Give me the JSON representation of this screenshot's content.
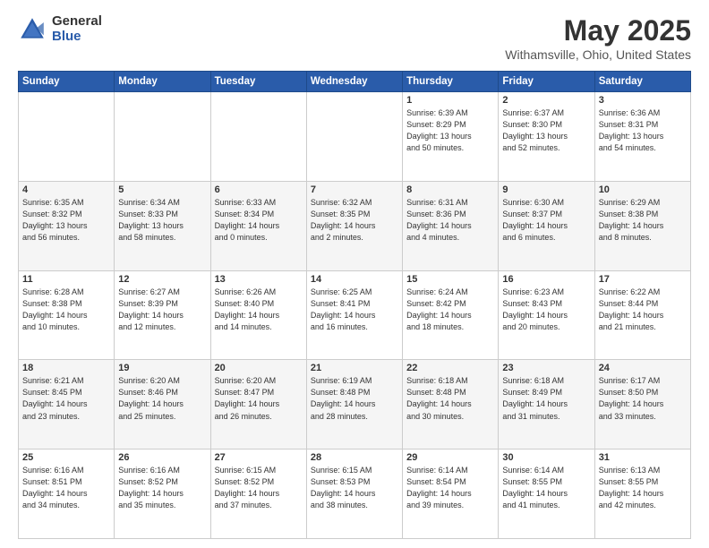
{
  "header": {
    "logo_general": "General",
    "logo_blue": "Blue",
    "title": "May 2025",
    "location": "Withamsville, Ohio, United States"
  },
  "days_of_week": [
    "Sunday",
    "Monday",
    "Tuesday",
    "Wednesday",
    "Thursday",
    "Friday",
    "Saturday"
  ],
  "weeks": [
    [
      {
        "day": "",
        "info": ""
      },
      {
        "day": "",
        "info": ""
      },
      {
        "day": "",
        "info": ""
      },
      {
        "day": "",
        "info": ""
      },
      {
        "day": "1",
        "info": "Sunrise: 6:39 AM\nSunset: 8:29 PM\nDaylight: 13 hours\nand 50 minutes."
      },
      {
        "day": "2",
        "info": "Sunrise: 6:37 AM\nSunset: 8:30 PM\nDaylight: 13 hours\nand 52 minutes."
      },
      {
        "day": "3",
        "info": "Sunrise: 6:36 AM\nSunset: 8:31 PM\nDaylight: 13 hours\nand 54 minutes."
      }
    ],
    [
      {
        "day": "4",
        "info": "Sunrise: 6:35 AM\nSunset: 8:32 PM\nDaylight: 13 hours\nand 56 minutes."
      },
      {
        "day": "5",
        "info": "Sunrise: 6:34 AM\nSunset: 8:33 PM\nDaylight: 13 hours\nand 58 minutes."
      },
      {
        "day": "6",
        "info": "Sunrise: 6:33 AM\nSunset: 8:34 PM\nDaylight: 14 hours\nand 0 minutes."
      },
      {
        "day": "7",
        "info": "Sunrise: 6:32 AM\nSunset: 8:35 PM\nDaylight: 14 hours\nand 2 minutes."
      },
      {
        "day": "8",
        "info": "Sunrise: 6:31 AM\nSunset: 8:36 PM\nDaylight: 14 hours\nand 4 minutes."
      },
      {
        "day": "9",
        "info": "Sunrise: 6:30 AM\nSunset: 8:37 PM\nDaylight: 14 hours\nand 6 minutes."
      },
      {
        "day": "10",
        "info": "Sunrise: 6:29 AM\nSunset: 8:38 PM\nDaylight: 14 hours\nand 8 minutes."
      }
    ],
    [
      {
        "day": "11",
        "info": "Sunrise: 6:28 AM\nSunset: 8:38 PM\nDaylight: 14 hours\nand 10 minutes."
      },
      {
        "day": "12",
        "info": "Sunrise: 6:27 AM\nSunset: 8:39 PM\nDaylight: 14 hours\nand 12 minutes."
      },
      {
        "day": "13",
        "info": "Sunrise: 6:26 AM\nSunset: 8:40 PM\nDaylight: 14 hours\nand 14 minutes."
      },
      {
        "day": "14",
        "info": "Sunrise: 6:25 AM\nSunset: 8:41 PM\nDaylight: 14 hours\nand 16 minutes."
      },
      {
        "day": "15",
        "info": "Sunrise: 6:24 AM\nSunset: 8:42 PM\nDaylight: 14 hours\nand 18 minutes."
      },
      {
        "day": "16",
        "info": "Sunrise: 6:23 AM\nSunset: 8:43 PM\nDaylight: 14 hours\nand 20 minutes."
      },
      {
        "day": "17",
        "info": "Sunrise: 6:22 AM\nSunset: 8:44 PM\nDaylight: 14 hours\nand 21 minutes."
      }
    ],
    [
      {
        "day": "18",
        "info": "Sunrise: 6:21 AM\nSunset: 8:45 PM\nDaylight: 14 hours\nand 23 minutes."
      },
      {
        "day": "19",
        "info": "Sunrise: 6:20 AM\nSunset: 8:46 PM\nDaylight: 14 hours\nand 25 minutes."
      },
      {
        "day": "20",
        "info": "Sunrise: 6:20 AM\nSunset: 8:47 PM\nDaylight: 14 hours\nand 26 minutes."
      },
      {
        "day": "21",
        "info": "Sunrise: 6:19 AM\nSunset: 8:48 PM\nDaylight: 14 hours\nand 28 minutes."
      },
      {
        "day": "22",
        "info": "Sunrise: 6:18 AM\nSunset: 8:48 PM\nDaylight: 14 hours\nand 30 minutes."
      },
      {
        "day": "23",
        "info": "Sunrise: 6:18 AM\nSunset: 8:49 PM\nDaylight: 14 hours\nand 31 minutes."
      },
      {
        "day": "24",
        "info": "Sunrise: 6:17 AM\nSunset: 8:50 PM\nDaylight: 14 hours\nand 33 minutes."
      }
    ],
    [
      {
        "day": "25",
        "info": "Sunrise: 6:16 AM\nSunset: 8:51 PM\nDaylight: 14 hours\nand 34 minutes."
      },
      {
        "day": "26",
        "info": "Sunrise: 6:16 AM\nSunset: 8:52 PM\nDaylight: 14 hours\nand 35 minutes."
      },
      {
        "day": "27",
        "info": "Sunrise: 6:15 AM\nSunset: 8:52 PM\nDaylight: 14 hours\nand 37 minutes."
      },
      {
        "day": "28",
        "info": "Sunrise: 6:15 AM\nSunset: 8:53 PM\nDaylight: 14 hours\nand 38 minutes."
      },
      {
        "day": "29",
        "info": "Sunrise: 6:14 AM\nSunset: 8:54 PM\nDaylight: 14 hours\nand 39 minutes."
      },
      {
        "day": "30",
        "info": "Sunrise: 6:14 AM\nSunset: 8:55 PM\nDaylight: 14 hours\nand 41 minutes."
      },
      {
        "day": "31",
        "info": "Sunrise: 6:13 AM\nSunset: 8:55 PM\nDaylight: 14 hours\nand 42 minutes."
      }
    ]
  ]
}
